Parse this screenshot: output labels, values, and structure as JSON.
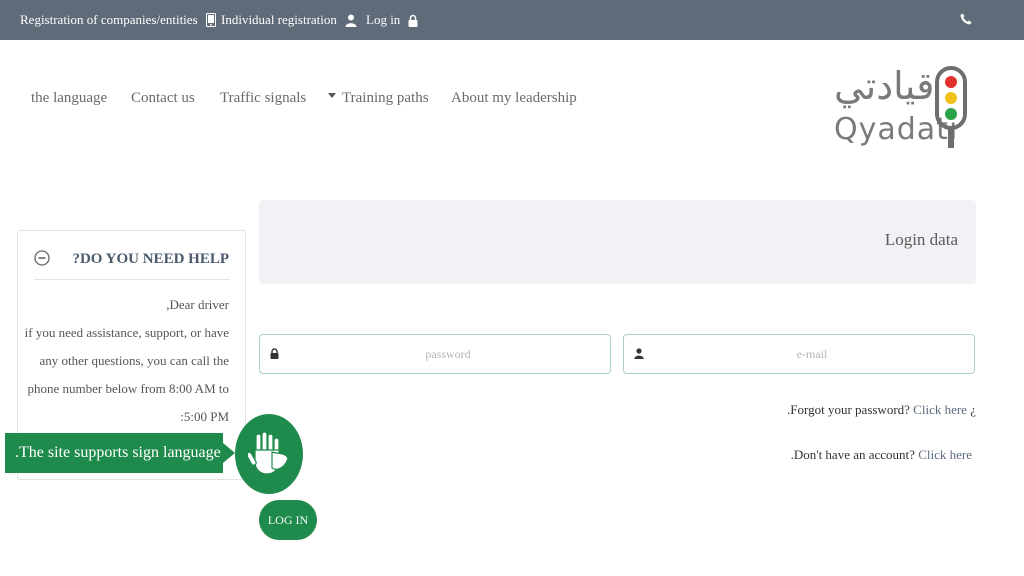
{
  "topbar": {
    "companies": "Registration of companies/entities",
    "individual": "Individual registration",
    "login": "Log in"
  },
  "nav": {
    "language": "the language",
    "contact": "Contact us",
    "traffic": "Traffic signals",
    "training": "Training paths",
    "about": "About my leadership"
  },
  "logo": {
    "arabic": "قيادتي",
    "latin": "Qyadati"
  },
  "login": {
    "header": "Login data",
    "password_placeholder": "password",
    "email_placeholder": "e-mail",
    "forgot_text": ".Forgot your password?",
    "forgot_link": "Click here",
    "forgot_suffix": "¿",
    "noacct_text": ".Don't have an account?",
    "noacct_link": "Click here",
    "button": "LOG IN"
  },
  "help": {
    "title": "?DO YOU NEED HELP",
    "line1": ",Dear driver",
    "line2": "if you need assistance, support, or have",
    "line3": "any other questions, you can call the",
    "line4": "phone number below from 8:00 AM to",
    "line5": ":5:00 PM"
  },
  "sign": {
    "label": ".The site supports sign language"
  },
  "colors": {
    "topbar": "#5f6b78",
    "accent_green": "#1e8a4c",
    "field_border": "#a9d3bd",
    "login_header_bg": "#f0f2f5"
  }
}
